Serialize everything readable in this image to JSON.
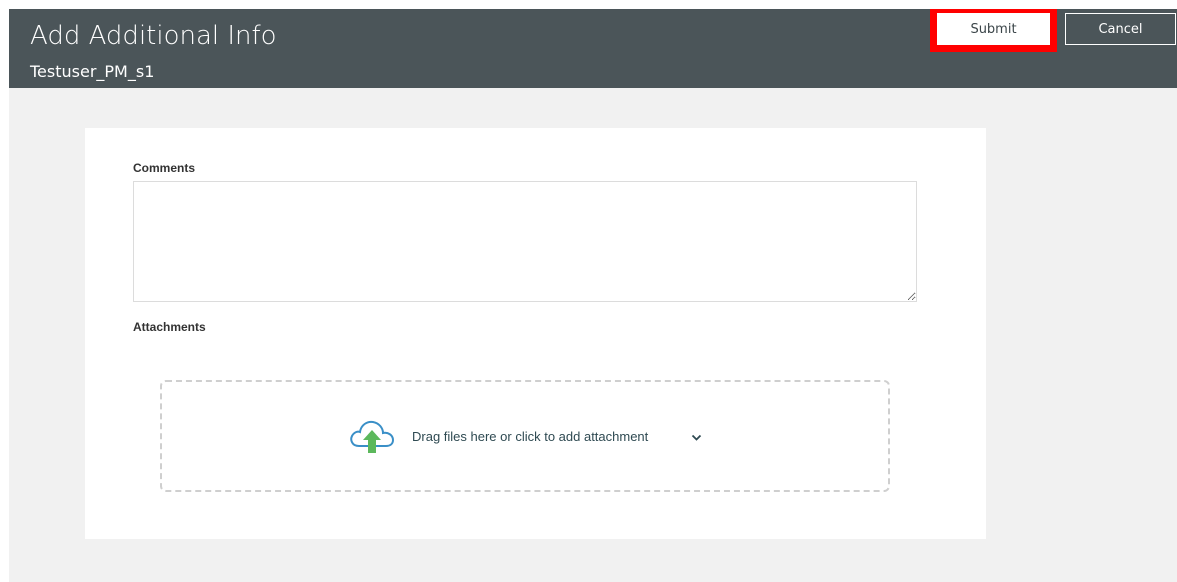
{
  "header": {
    "title": "Add Additional Info",
    "subtitle": "Testuser_PM_s1",
    "submit_label": "Submit",
    "cancel_label": "Cancel"
  },
  "form": {
    "comments_label": "Comments",
    "comments_value": "",
    "attachments_label": "Attachments",
    "dropzone_text": "Drag files here or click to add attachment"
  },
  "colors": {
    "header_bg": "#4b5559",
    "page_bg": "#f1f1f1",
    "highlight": "#ff0000",
    "upload_arrow": "#5cb85c"
  },
  "icons": {
    "upload": "cloud-upload-icon",
    "dropdown": "chevron-down-icon"
  }
}
